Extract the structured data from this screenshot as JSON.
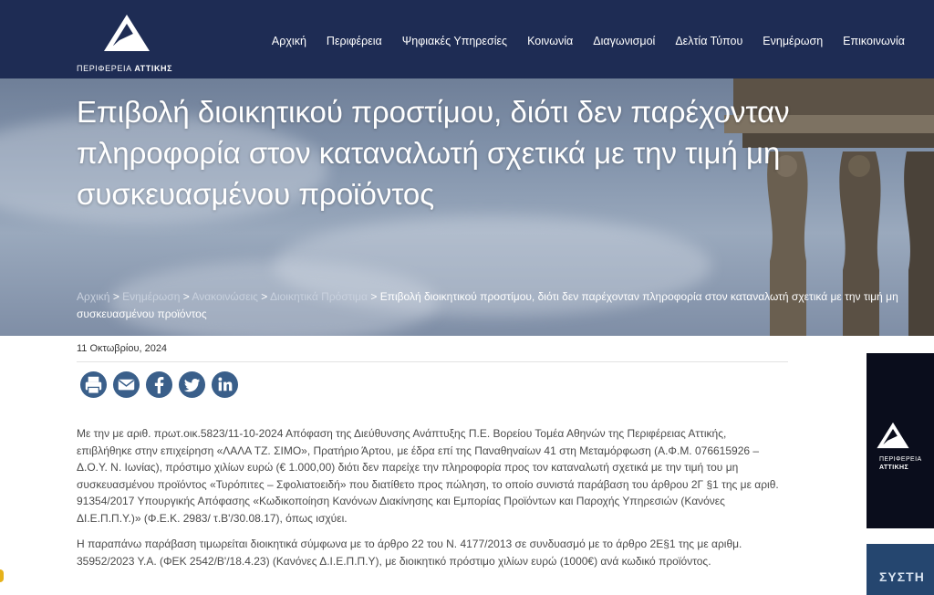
{
  "header": {
    "logo_text_prefix": "ΠΕΡΙΦΕΡΕΙΑ ",
    "logo_text_bold": "ΑΤΤΙΚΗΣ",
    "nav": [
      "Αρχική",
      "Περιφέρεια",
      "Ψηφιακές Υπηρεσίες",
      "Κοινωνία",
      "Διαγωνισμοί",
      "Δελτία Τύπου",
      "Ενημέρωση",
      "Επικοινωνία"
    ]
  },
  "hero": {
    "title": "Επιβολή διοικητικού προστίμου, διότι δεν παρέχονταν πληροφορία στον καταναλωτή σχετικά με την τιμή μη συσκευασμένου προϊόντος"
  },
  "breadcrumb": {
    "items": [
      "Αρχική",
      "Ενημέρωση",
      "Ανακοινώσεις",
      "Διοικητικά Πρόστιμα"
    ],
    "separator": ">",
    "current": "Επιβολή διοικητικού προστίμου, διότι δεν παρέχονταν πληροφορία στον καταναλωτή σχετικά με την τιμή μη συσκευασμένου προϊόντος"
  },
  "article": {
    "date": "11 Οκτωβρίου, 2024",
    "share_icons": [
      "print-icon",
      "email-icon",
      "facebook-icon",
      "twitter-icon",
      "linkedin-icon"
    ],
    "paragraphs": [
      "Με την με αριθ. πρωτ.οικ.5823/11-10-2024 Απόφαση της Διεύθυνσης Ανάπτυξης Π.Ε. Βορείου Τομέα Αθηνών της Περιφέρειας Αττικής, επιβλήθηκε στην επιχείρηση «ΛΑΛΑ ΤΖ. ΣΙΜΟ», Πρατήριο Άρτου, με έδρα επί της Παναθηναίων 41 στη Μεταμόρφωση (Α.Φ.Μ. 076615926 – Δ.Ο.Υ. Ν. Ιωνίας), πρόστιμο χιλίων ευρώ (€ 1.000,00) διότι δεν παρείχε την πληροφορία προς τον καταναλωτή σχετικά με την τιμή του μη συσκευασμένου προϊόντος «Τυρόπιτες – Σφολιατοειδή» που διατίθετο προς πώληση, το οποίο συνιστά παράβαση του άρθρου 2Γ §1 της με αριθ. 91354/2017 Υπουργικής Απόφασης «Κωδικοποίηση Κανόνων Διακίνησης και Εμπορίας Προϊόντων και Παροχής Υπηρεσιών (Κανόνες ΔΙ.Ε.Π.Π.Υ.)» (Φ.Ε.Κ. 2983/ τ.Β'/30.08.17), όπως ισχύει.",
      "Η παραπάνω παράβαση τιμωρείται διοικητικά σύμφωνα με το άρθρο 22 του Ν. 4177/2013 σε συνδυασμό με το άρθρο 2Ε§1 της με αριθμ. 35952/2023 Υ.Α. (ΦΕΚ 2542/Β'/18.4.23) (Κανόνες Δ.Ι.Ε.Π.Π.Υ), με διοικητικό πρόστιμο χιλίων ευρώ (1000€) ανά κωδικό προϊόντος."
    ]
  },
  "sidebar": {
    "banner1_line1": "ΠΕΡΙΦΕΡΕΙΑ",
    "banner1_line2": "ΑΤΤΙΚΗΣ",
    "banner2_text": "ΣΥΣΤΗ"
  },
  "colors": {
    "header_bg": "#1e2c54",
    "body_text": "#4a4a4a",
    "share_icon": "#3a5f8a"
  }
}
